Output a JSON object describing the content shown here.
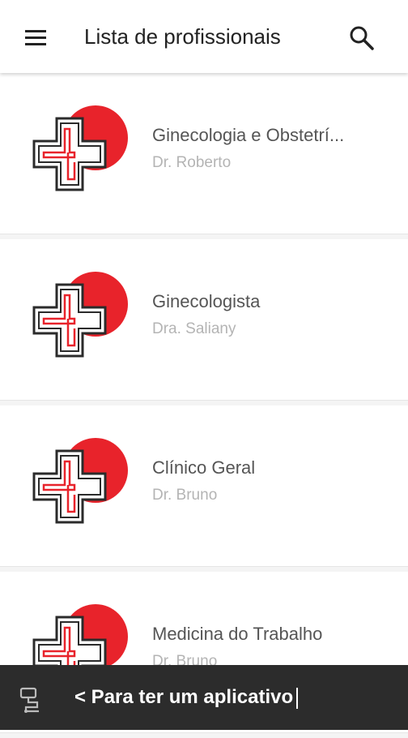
{
  "header": {
    "title": "Lista de profissionais",
    "menu_icon": "hamburger-menu-icon",
    "search_icon": "search-icon"
  },
  "professionals": [
    {
      "specialty": "Ginecologia e Obstetrí...",
      "doctor": "Dr. Roberto"
    },
    {
      "specialty": "Ginecologista",
      "doctor": "Dra. Saliany"
    },
    {
      "specialty": "Clínico Geral",
      "doctor": "Dr. Bruno"
    },
    {
      "specialty": "Medicina do Trabalho",
      "doctor": "Dr. Bruno"
    }
  ],
  "banner": {
    "text": "< Para ter um aplicativo",
    "icon": "app-builder-icon"
  },
  "colors": {
    "brand_red": "#e8232b",
    "cross_outline": "#2b2b2b",
    "banner_bg": "#2c2c2c"
  }
}
